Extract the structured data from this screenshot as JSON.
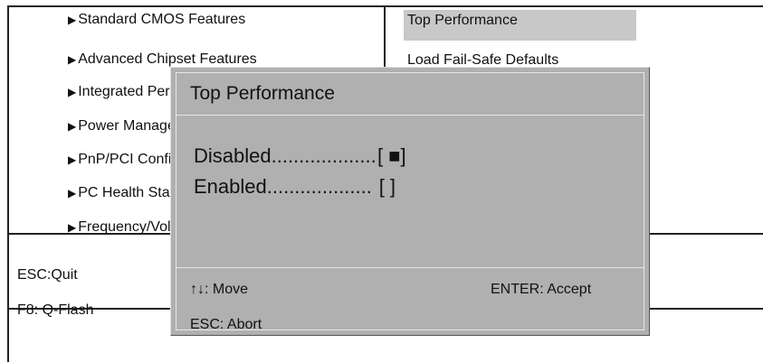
{
  "left_menu": [
    {
      "label": "Standard CMOS Features"
    },
    {
      "label": "Advanced Chipset Features"
    },
    {
      "label": "Integrated Peripherals"
    },
    {
      "label": "Power Management Setup"
    },
    {
      "label": "PnP/PCI Configurations"
    },
    {
      "label": "PC Health Status"
    },
    {
      "label": "Frequency/Voltage Control"
    }
  ],
  "right_menu": [
    {
      "label": "Top Performance",
      "selected": true
    },
    {
      "label": "Load Fail-Safe Defaults"
    }
  ],
  "bottom_keys": {
    "quit": "ESC:Quit",
    "flash": "F8: Q-Flash"
  },
  "dialog": {
    "title": "Top Performance",
    "options": [
      {
        "label": "Disabled...................",
        "mark": "[ ■]",
        "selected": true
      },
      {
        "label": "Enabled...................",
        "mark": "[   ]",
        "selected": false
      }
    ],
    "footer": {
      "move": "↑↓: Move",
      "accept": "ENTER: Accept",
      "abort": "ESC: Abort"
    }
  }
}
